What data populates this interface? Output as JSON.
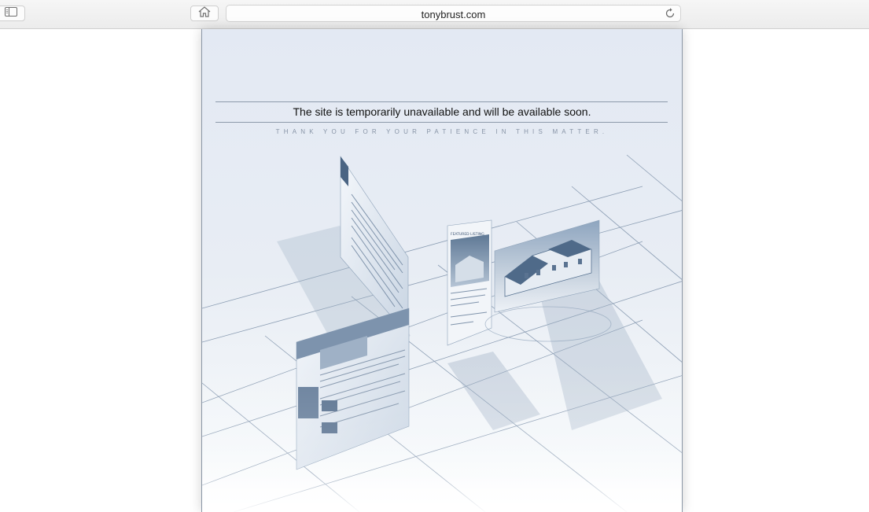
{
  "browser": {
    "url": "tonybrust.com",
    "icons": {
      "sidebar": "sidebar-icon",
      "home": "home-icon",
      "reload": "reload-icon"
    }
  },
  "page": {
    "headline": "The site is temporarily unavailable and will be available soon.",
    "subline": "THANK YOU FOR YOUR PATIENCE IN THIS MATTER.",
    "illustration": {
      "listing_title": "FEATURED LISTING"
    }
  },
  "colors": {
    "page_background": "#e6ebf3",
    "rule": "#8d9aab",
    "subline": "#8794a6",
    "illustration_ink": "#4a6483"
  }
}
